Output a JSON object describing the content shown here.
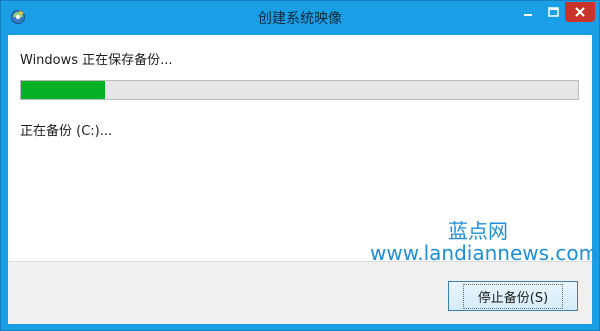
{
  "window": {
    "title": "创建系统映像"
  },
  "dialog": {
    "status": "Windows 正在保存备份...",
    "progress_fraction": 0.15,
    "sub_status": "正在备份 (C:)..."
  },
  "buttons": {
    "stop_label": "停止备份(S)"
  },
  "watermark": {
    "brand": "蓝点网",
    "url": "www.landiannews.com"
  },
  "colors": {
    "title_bar": "#1a9ee6",
    "progress_fill": "#06b025",
    "close_button": "#c9342a",
    "watermark": "#1f8fd8"
  }
}
